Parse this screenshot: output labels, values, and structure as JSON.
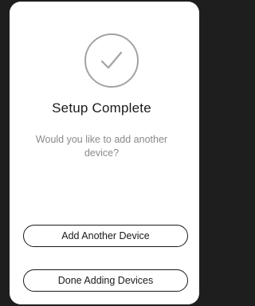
{
  "dialog": {
    "icon": "checkmark-circle-icon",
    "title": "Setup Complete",
    "message": "Would you like to add another device?",
    "buttons": {
      "add_another": "Add Another Device",
      "done": "Done Adding Devices"
    }
  },
  "colors": {
    "background": "#1e1e1e",
    "card": "#ffffff",
    "title_text": "#1a1a1a",
    "subtitle_text": "#8a8a8a",
    "icon_stroke": "#a3a3a3",
    "button_border": "#1a1a1a"
  }
}
